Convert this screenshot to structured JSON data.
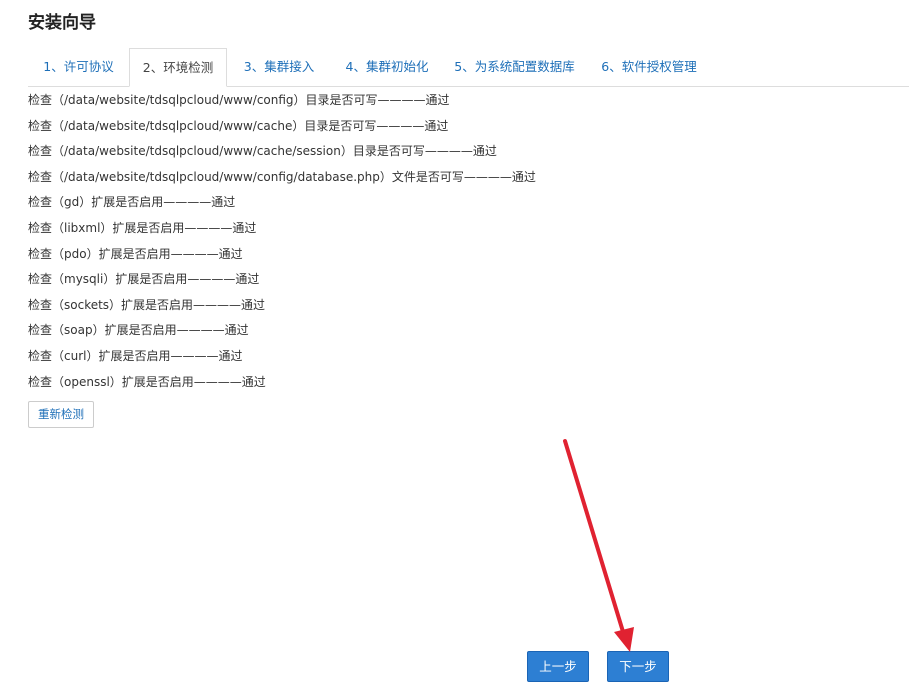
{
  "header": {
    "title": "安装向导"
  },
  "tabs": [
    {
      "label": "1、许可协议"
    },
    {
      "label": "2、环境检测"
    },
    {
      "label": "3、集群接入"
    },
    {
      "label": "4、集群初始化"
    },
    {
      "label": "5、为系统配置数据库"
    },
    {
      "label": "6、软件授权管理"
    }
  ],
  "active_tab": "2、环境检测",
  "checks": [
    "检查（/data/website/tdsqlpcloud/www/config）目录是否可写————通过",
    "检查（/data/website/tdsqlpcloud/www/cache）目录是否可写————通过",
    "检查（/data/website/tdsqlpcloud/www/cache/session）目录是否可写————通过",
    "检查（/data/website/tdsqlpcloud/www/config/database.php）文件是否可写————通过",
    "检查（gd）扩展是否启用————通过",
    "检查（libxml）扩展是否启用————通过",
    "检查（pdo）扩展是否启用————通过",
    "检查（mysqli）扩展是否启用————通过",
    "检查（sockets）扩展是否启用————通过",
    "检查（soap）扩展是否启用————通过",
    "检查（curl）扩展是否启用————通过",
    "检查（openssl）扩展是否启用————通过"
  ],
  "buttons": {
    "recheck": "重新检测",
    "prev": "上一步",
    "next": "下一步"
  },
  "colors": {
    "link": "#1e6fb8",
    "primary": "#2d7fd3",
    "annotation_arrow": "#e02231"
  },
  "annotation": {
    "icon": "red-arrow-icon",
    "points_to": "下一步"
  }
}
